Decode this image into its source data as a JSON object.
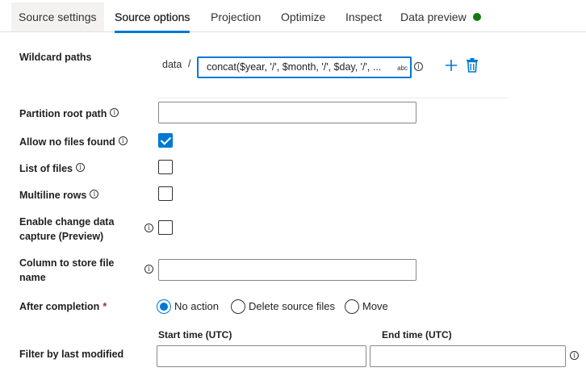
{
  "tabs": [
    {
      "label": "Source settings"
    },
    {
      "label": "Source options"
    },
    {
      "label": "Projection"
    },
    {
      "label": "Optimize"
    },
    {
      "label": "Inspect"
    },
    {
      "label": "Data preview"
    }
  ],
  "active_tab": "Source options",
  "status_color": "#107c10",
  "wildcard": {
    "label": "Wildcard paths",
    "prefix": "data",
    "separator": "/",
    "value": "concat($year, '/', $month, '/', $day, '/', ...",
    "badge": "abc",
    "add_icon": "plus-icon",
    "delete_icon": "trash-icon"
  },
  "partition_root": {
    "label": "Partition root path",
    "value": ""
  },
  "allow_no_files": {
    "label": "Allow no files found",
    "checked": true
  },
  "list_of_files": {
    "label": "List of files",
    "checked": false
  },
  "multiline_rows": {
    "label": "Multiline rows",
    "checked": false
  },
  "change_capture": {
    "label_line1": "Enable change data",
    "label_line2": "capture (Preview)",
    "checked": false
  },
  "column_store": {
    "label_line1": "Column to store file",
    "label_line2": "name",
    "value": ""
  },
  "after_completion": {
    "label": "After completion",
    "required_mark": "*",
    "options": [
      "No action",
      "Delete source files",
      "Move"
    ],
    "selected": "No action"
  },
  "filter_modified": {
    "label": "Filter by last modified",
    "start_label": "Start time (UTC)",
    "end_label": "End time (UTC)",
    "start_value": "",
    "end_value": ""
  },
  "info_glyph": "i"
}
